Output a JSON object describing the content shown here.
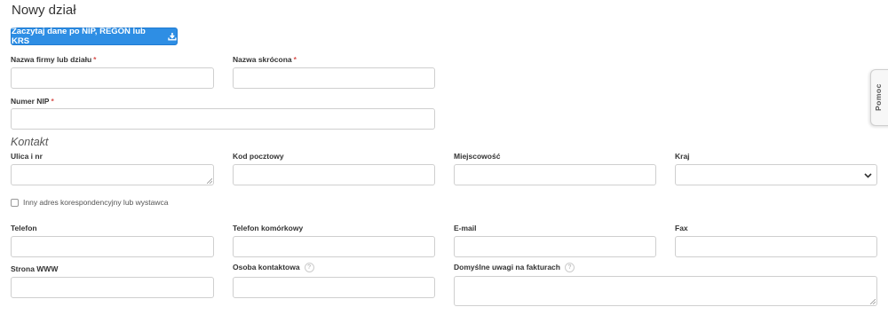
{
  "page": {
    "title": "Nowy dział"
  },
  "actions": {
    "fetch_label": "Zaczytaj dane po NIP, REGON lub KRS"
  },
  "company": {
    "name_label": "Nazwa firmy lub działu",
    "short_name_label": "Nazwa skrócona",
    "nip_label": "Numer NIP",
    "required_mark": "*"
  },
  "contact": {
    "section_title": "Kontakt",
    "street_label": "Ulica i nr",
    "postal_label": "Kod pocztowy",
    "city_label": "Miejscowość",
    "country_label": "Kraj",
    "other_address_label": "Inny adres korespondencyjny lub wystawca",
    "phone_label": "Telefon",
    "mobile_label": "Telefon komórkowy",
    "email_label": "E-mail",
    "fax_label": "Fax",
    "www_label": "Strona WWW",
    "contact_person_label": "Osoba kontaktowa",
    "invoice_notes_label": "Domyślne uwagi na fakturach",
    "help_mark": "?"
  },
  "sidebar": {
    "help_tab_label": "Pomoc"
  },
  "icons": {
    "download": "download-icon",
    "chevron": "chevron-down-icon",
    "help": "question-icon"
  },
  "colors": {
    "primary": "#2e8ee4",
    "required": "#d9534f"
  }
}
